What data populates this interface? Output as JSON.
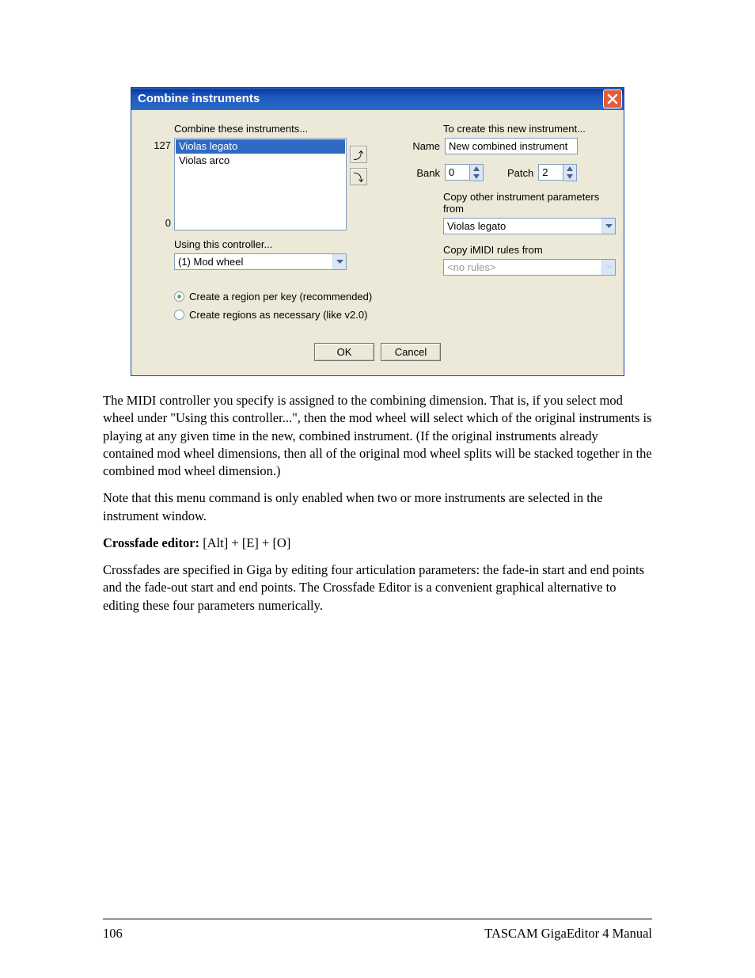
{
  "dialog": {
    "title": "Combine instruments",
    "combine_label": "Combine these instruments...",
    "num_high": "127",
    "num_low": "0",
    "list_items": [
      "Violas legato",
      "Violas arco"
    ],
    "controller_label": "Using this controller...",
    "controller_value": "(1) Mod wheel",
    "radio1": "Create a region per key (recommended)",
    "radio2": "Create regions as necessary (like v2.0)",
    "create_label": "To create this new instrument...",
    "name_label": "Name",
    "name_value": "New combined instrument",
    "bank_label": "Bank",
    "bank_value": "0",
    "patch_label": "Patch",
    "patch_value": "2",
    "copy_params_label": "Copy other instrument parameters from",
    "copy_params_value": "Violas legato",
    "copy_imidi_label": "Copy iMIDI rules from",
    "copy_imidi_value": "<no rules>",
    "ok": "OK",
    "cancel": "Cancel"
  },
  "para1": "The MIDI controller you specify is assigned to the combining dimension.  That is, if you select mod wheel under \"Using this controller...\", then the mod wheel will select which of the original instruments is playing at any given time in the new, combined instrument.  (If the original instruments already contained mod wheel dimensions, then all of the original mod wheel splits will be stacked together in the combined mod wheel dimension.)",
  "para2": "Note that this menu command is only enabled when two or more instruments are selected in the instrument window.",
  "crossfade_bold": "Crossfade editor:",
  "crossfade_rest": " [Alt] + [E] + [O]",
  "para3": "Crossfades are specified in Giga by editing four articulation parameters: the fade-in start and end points and the fade-out start and end points.  The Crossfade Editor is a convenient graphical alternative to editing these four parameters numerically.",
  "footer": {
    "page": "106",
    "title": "TASCAM GigaEditor 4 Manual"
  }
}
